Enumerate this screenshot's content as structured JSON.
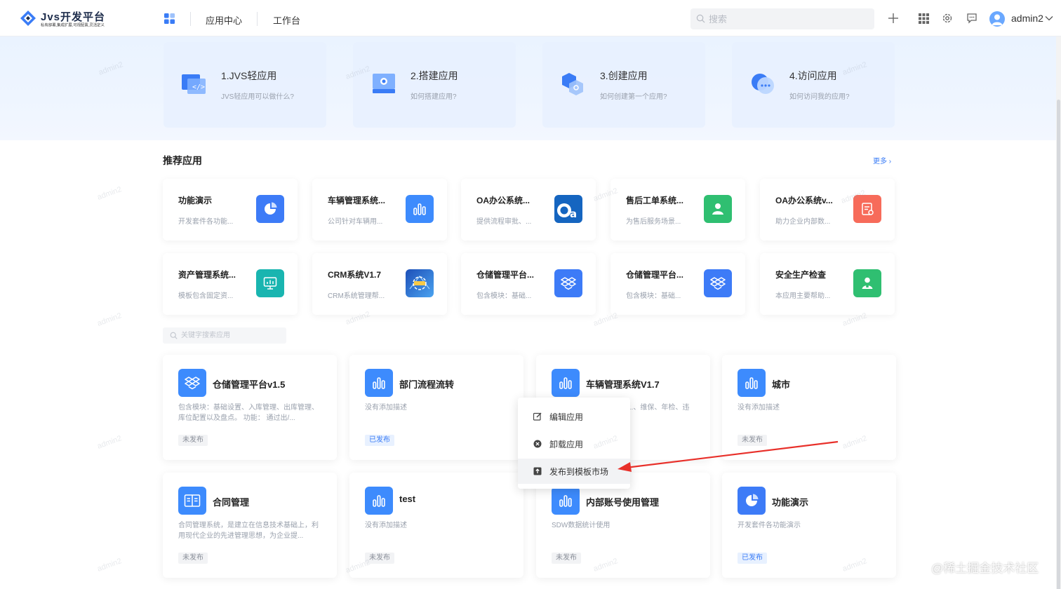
{
  "header": {
    "logo_title": "Jvs开发平台",
    "logo_subtitle": "私有部署,集成扩展,可视配置,灵活定义",
    "nav": [
      "应用中心",
      "工作台"
    ],
    "search_placeholder": "搜索",
    "username": "admin2"
  },
  "guides": [
    {
      "title": "1.JVS轻应用",
      "desc": "JVS轻应用可以做什么?"
    },
    {
      "title": "2.搭建应用",
      "desc": "如何搭建应用?"
    },
    {
      "title": "3.创建应用",
      "desc": "如何创建第一个应用?"
    },
    {
      "title": "4.访问应用",
      "desc": "如何访问我的应用?"
    }
  ],
  "recommended": {
    "title": "推荐应用",
    "more": "更多",
    "items": [
      {
        "name": "功能演示",
        "desc": "开发套件各功能...",
        "icon": "pie-chart-icon",
        "color": "#3d7bf7"
      },
      {
        "name": "车辆管理系统...",
        "desc": "公司针对车辆用...",
        "icon": "bar-chart-icon",
        "color": "#3d8bfd"
      },
      {
        "name": "OA办公系统...",
        "desc": "提供流程审批、...",
        "icon": "oa-logo-icon",
        "color": "#1565c0"
      },
      {
        "name": "售后工单系统...",
        "desc": "为售后服务场景...",
        "icon": "service-person-icon",
        "color": "#2fbf71"
      },
      {
        "name": "OA办公系统v...",
        "desc": "助力企业内部数...",
        "icon": "document-edit-icon",
        "color": "#f76b5a"
      },
      {
        "name": "资产管理系统...",
        "desc": "模板包含固定资...",
        "icon": "monitor-chart-icon",
        "color": "#19b5b0"
      },
      {
        "name": "CRM系统V1.7",
        "desc": "CRM系统管理帮...",
        "icon": "crm-image-icon",
        "color": "#2b6cd4"
      },
      {
        "name": "仓储管理平台...",
        "desc": "包含模块：基础...",
        "icon": "dropbox-icon",
        "color": "#3d7bf7"
      },
      {
        "name": "仓储管理平台...",
        "desc": "包含模块：基础...",
        "icon": "dropbox-icon",
        "color": "#3d7bf7"
      },
      {
        "name": "安全生产检查",
        "desc": "本应用主要帮助...",
        "icon": "inspector-icon",
        "color": "#2fbf71"
      }
    ]
  },
  "app_search_placeholder": "关键字搜索应用",
  "apps": [
    {
      "name": "仓储管理平台v1.5",
      "desc": "包含模块：基础设置、入库管理、出库管理、库位配置以及盘点。 功能： 通过出/...",
      "status": "未发布",
      "published": false,
      "icon": "dropbox-icon"
    },
    {
      "name": "部门流程流转",
      "desc": "没有添加描述",
      "status": "已发布",
      "published": true,
      "icon": "bar-chart-icon"
    },
    {
      "name": "车辆管理系统V1.7",
      "desc": "...、维保、年检、违",
      "status": "",
      "published": false,
      "icon": "bar-chart-icon"
    },
    {
      "name": "城市",
      "desc": "没有添加描述",
      "status": "未发布",
      "published": false,
      "icon": "bar-chart-icon"
    },
    {
      "name": "合同管理",
      "desc": "合同管理系统，是建立在信息技术基础上，利用现代企业的先进管理思想，为企业提...",
      "status": "未发布",
      "published": false,
      "icon": "book-icon"
    },
    {
      "name": "test",
      "desc": "没有添加描述",
      "status": "未发布",
      "published": false,
      "icon": "bar-chart-icon"
    },
    {
      "name": "内部账号使用管理",
      "desc": "SDW数据统计使用",
      "status": "未发布",
      "published": false,
      "icon": "bar-chart-icon"
    },
    {
      "name": "功能演示",
      "desc": "开发套件各功能演示",
      "status": "已发布",
      "published": true,
      "icon": "pie-chart-icon"
    }
  ],
  "context_menu": {
    "items": [
      {
        "label": "编辑应用",
        "icon": "edit-icon"
      },
      {
        "label": "卸载应用",
        "icon": "uninstall-icon"
      },
      {
        "label": "发布到模板市场",
        "icon": "publish-icon"
      }
    ]
  },
  "watermark": "admin2",
  "site_credit": "@稀土掘金技术社区",
  "colors": {
    "accent": "#3a7cf6",
    "arrow": "#e8302a"
  }
}
